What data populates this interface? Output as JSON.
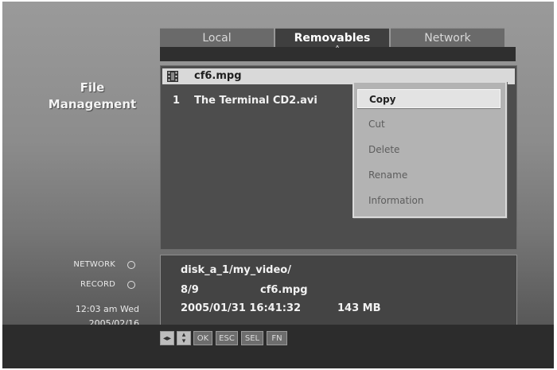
{
  "screen": {
    "title": "File Management"
  },
  "sidebar": {
    "title_line1": "File",
    "title_line2": "Management"
  },
  "tabs": [
    {
      "label": "Local",
      "active": false
    },
    {
      "label": "Removables",
      "active": true
    },
    {
      "label": "Network",
      "active": false
    }
  ],
  "files": [
    {
      "index": "",
      "name": "cf6.mpg",
      "selected": true,
      "icon": "film-icon"
    },
    {
      "index": "1",
      "name": "The Terminal CD2.avi",
      "selected": false,
      "icon": ""
    }
  ],
  "context_menu": {
    "items": [
      {
        "label": "Copy",
        "selected": true
      },
      {
        "label": "Cut",
        "selected": false
      },
      {
        "label": "Delete",
        "selected": false
      },
      {
        "label": "Rename",
        "selected": false
      },
      {
        "label": "Information",
        "selected": false
      }
    ]
  },
  "status": {
    "network_label": "NETWORK",
    "record_label": "RECORD",
    "time": "12:03 am Wed",
    "date": "2005/02/16"
  },
  "info": {
    "path": "disk_a_1/my_video/",
    "position": "8/9",
    "filename": "cf6.mpg",
    "datetime": "2005/01/31 16:41:32",
    "size": "143 MB"
  },
  "keys": {
    "left_right_icon": "left-right-arrows-icon",
    "up_down_icon": "up-down-arrows-icon",
    "ok": "OK",
    "esc": "ESC",
    "sel": "SEL",
    "fn": "FN"
  },
  "colors": {
    "accent": "#d9d9d9",
    "panel": "#4d4d4d",
    "background": "#8c8c8c"
  }
}
